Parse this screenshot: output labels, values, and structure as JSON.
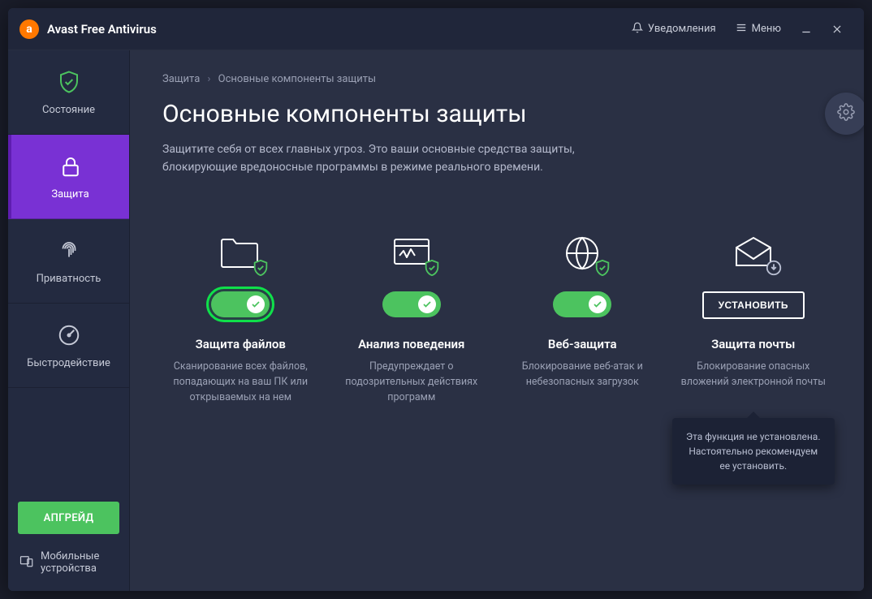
{
  "app": {
    "title": "Avast Free Antivirus"
  },
  "titlebar": {
    "notifications": "Уведомления",
    "menu": "Меню"
  },
  "sidebar": {
    "items": [
      {
        "label": "Состояние"
      },
      {
        "label": "Защита"
      },
      {
        "label": "Приватность"
      },
      {
        "label": "Быстродействие"
      }
    ],
    "upgrade": "АПГРЕЙД",
    "mobile": "Мобильные устройства"
  },
  "breadcrumb": {
    "root": "Защита",
    "current": "Основные компоненты защиты"
  },
  "page": {
    "title": "Основные компоненты защиты",
    "subtitle": "Защитите себя от всех главных угроз. Это ваши основные средства защиты, блокирующие вредоносные программы в режиме реального времени."
  },
  "install_label": "УСТАНОВИТЬ",
  "shields": [
    {
      "title": "Защита файлов",
      "desc": "Сканирование всех файлов, попадающих на ваш ПК или открываемых на нем"
    },
    {
      "title": "Анализ поведения",
      "desc": "Предупреждает о подозрительных действиях программ"
    },
    {
      "title": "Веб-защита",
      "desc": "Блокирование веб-атак и небезопасных загрузок"
    },
    {
      "title": "Защита почты",
      "desc": "Блокирование опасных вложений электронной почты"
    }
  ],
  "tooltip": "Эта функция не установлена. Настоятельно рекомендуем ее установить.",
  "colors": {
    "accent": "#7931d4",
    "success": "#4cc35f",
    "brand": "#ff7800"
  }
}
